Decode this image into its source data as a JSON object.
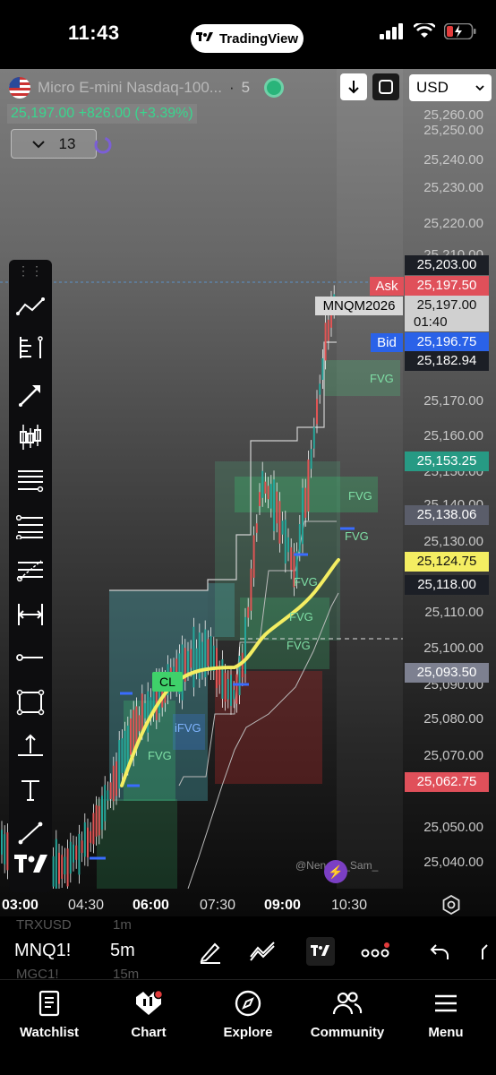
{
  "status": {
    "time": "11:43",
    "app_pill": "TradingView"
  },
  "header": {
    "symbol_name": "Micro E-mini Nasdaq-100...",
    "dot": "·",
    "interval": "5",
    "price_line": "25,197.00 +826.00 (+3.39%)",
    "interval_select": "13",
    "currency": "USD"
  },
  "y_axis": {
    "ticks": [
      "25,260.00",
      "25,250.00",
      "25,240.00",
      "25,230.00",
      "25,220.00",
      "25,210.00",
      "25,170.00",
      "25,160.00",
      "25,150.00",
      "25,140.00",
      "25,130.00",
      "25,110.00",
      "25,100.00",
      "25,090.00",
      "25,080.00",
      "25,070.00",
      "25,050.00",
      "25,040.00"
    ],
    "tags": {
      "high": "25,203.00",
      "ask_label": "Ask",
      "ask": "25,197.50",
      "symbol": "MNQM2026",
      "last": "25,197.00",
      "countdown": "01:40",
      "bid_label": "Bid",
      "bid": "25,196.75",
      "level_a": "25,182.94",
      "level_b": "25,153.25",
      "level_c": "25,138.06",
      "level_d": "25,124.75",
      "level_e": "25,118.00",
      "level_f": "25,093.50",
      "level_g": "25,062.75"
    }
  },
  "x_axis": {
    "labels": [
      {
        "text": "03:00",
        "bold": true
      },
      {
        "text": "04:30",
        "bold": false
      },
      {
        "text": "06:00",
        "bold": true
      },
      {
        "text": "07:30",
        "bold": false
      },
      {
        "text": "09:00",
        "bold": true
      },
      {
        "text": "10:30",
        "bold": false
      }
    ]
  },
  "chart_labels": {
    "fvg": "FVG",
    "ifvg": "iFVG",
    "cl": "CL",
    "author": "@Nen____Sam_"
  },
  "colors": {
    "accent_green": "#26a69a",
    "accent_red": "#e05555",
    "ask_red": "#e0505a",
    "bid_blue": "#2a62e8",
    "ma_yellow": "#f4ee62"
  },
  "strip": {
    "ghost_top": "TRXUSD",
    "ghost_top_int": "1m",
    "symbol": "MNQ1!",
    "interval": "5m",
    "ghost_bottom": "MGC1!",
    "ghost_bottom_int": "15m"
  },
  "nav": {
    "items": [
      {
        "label": "Watchlist",
        "icon": "book-icon"
      },
      {
        "label": "Chart",
        "icon": "chart-icon"
      },
      {
        "label": "Explore",
        "icon": "compass-icon"
      },
      {
        "label": "Community",
        "icon": "people-icon"
      },
      {
        "label": "Menu",
        "icon": "hamburger-icon"
      }
    ]
  }
}
